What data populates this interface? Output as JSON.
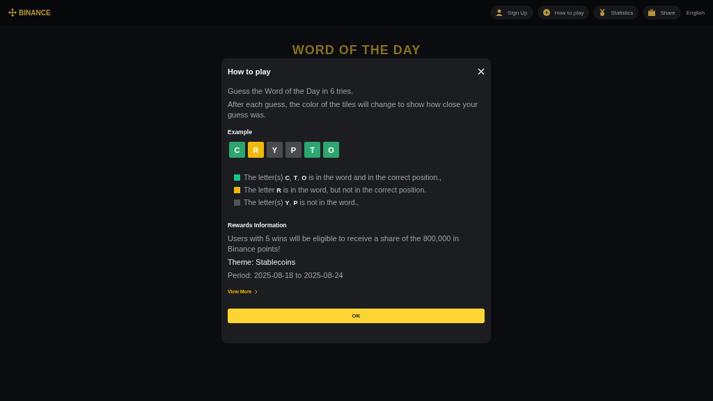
{
  "header": {
    "logo": "BINANCE",
    "nav": [
      {
        "kind": "user",
        "label": "Sign Up"
      },
      {
        "kind": "play",
        "label": "How to play"
      },
      {
        "kind": "medal",
        "label": "Statistics"
      },
      {
        "kind": "gift",
        "label": "Share"
      }
    ],
    "language": "English"
  },
  "page_title": "WORD OF THE DAY",
  "dialog": {
    "title": "How to play",
    "intro": [
      "Guess the Word of the Day in 6 tries.",
      "After each guess, the color of the tiles will change to show how close your guess was."
    ],
    "example_label": "Example",
    "tiles": [
      {
        "letter": "C",
        "kind": "correct"
      },
      {
        "letter": "R",
        "kind": "present"
      },
      {
        "letter": "Y",
        "kind": "absent"
      },
      {
        "letter": "P",
        "kind": "absent"
      },
      {
        "letter": "T",
        "kind": "correct"
      },
      {
        "letter": "O",
        "kind": "correct"
      }
    ],
    "legend": [
      {
        "kind": "correct",
        "text": "The letter(s) **C**, **T**, **O** is in the word and in the correct position.,"
      },
      {
        "kind": "present",
        "text": "The letter **R** is in the word, but not in the correct position."
      },
      {
        "kind": "absent",
        "text": "The letter(s) **Y**, **P** is not in the word.,"
      }
    ],
    "rewards_label": "Rewards Information",
    "rewards_text": "Users with 5 wins will be eligible to receive a share of the 800,000 in Binance points!",
    "theme": "Theme: Stablecoins",
    "period": "Period: 2025-08-18 to 2025-08-24",
    "view_more": "View More",
    "ok": "OK"
  }
}
